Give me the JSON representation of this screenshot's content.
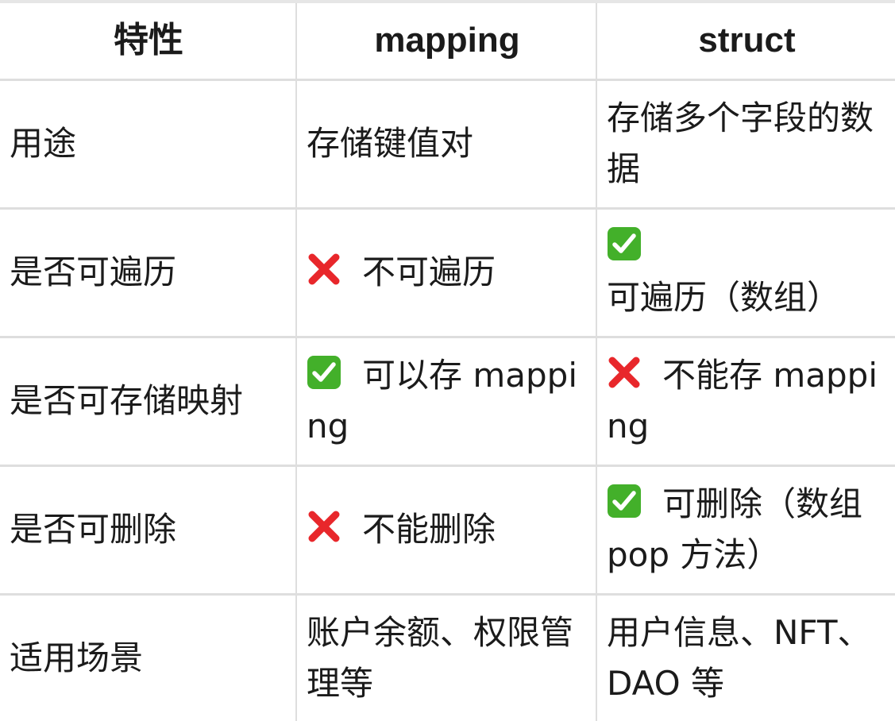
{
  "header": [
    "特性",
    "mapping",
    "struct"
  ],
  "rows": [
    {
      "feature": "用途",
      "mapping": {
        "icon": "",
        "text": "存储键值对"
      },
      "struct": {
        "icon": "",
        "text": "存储多个字段的数据"
      }
    },
    {
      "feature": "是否可遍历",
      "mapping": {
        "icon": "cross-mark-icon",
        "text": "不可遍历"
      },
      "struct": {
        "icon": "check-mark-icon",
        "text": "可遍历（数组）"
      }
    },
    {
      "feature": "是否可存储映射",
      "mapping": {
        "icon": "check-mark-icon",
        "text": "可以存 mapping"
      },
      "struct": {
        "icon": "cross-mark-icon",
        "text": "不能存 mapping"
      }
    },
    {
      "feature": "是否可删除",
      "mapping": {
        "icon": "cross-mark-icon",
        "text": "不能删除"
      },
      "struct": {
        "icon": "check-mark-icon",
        "text": "可删除（数组 pop 方法）"
      }
    },
    {
      "feature": "适用场景",
      "mapping": {
        "icon": "",
        "text": "账户余额、权限管理等"
      },
      "struct": {
        "icon": "",
        "text": "用户信息、NFT、DAO 等"
      }
    }
  ],
  "colors": {
    "check": "#43b02a",
    "cross": "#e8272b",
    "border": "#dedede"
  }
}
